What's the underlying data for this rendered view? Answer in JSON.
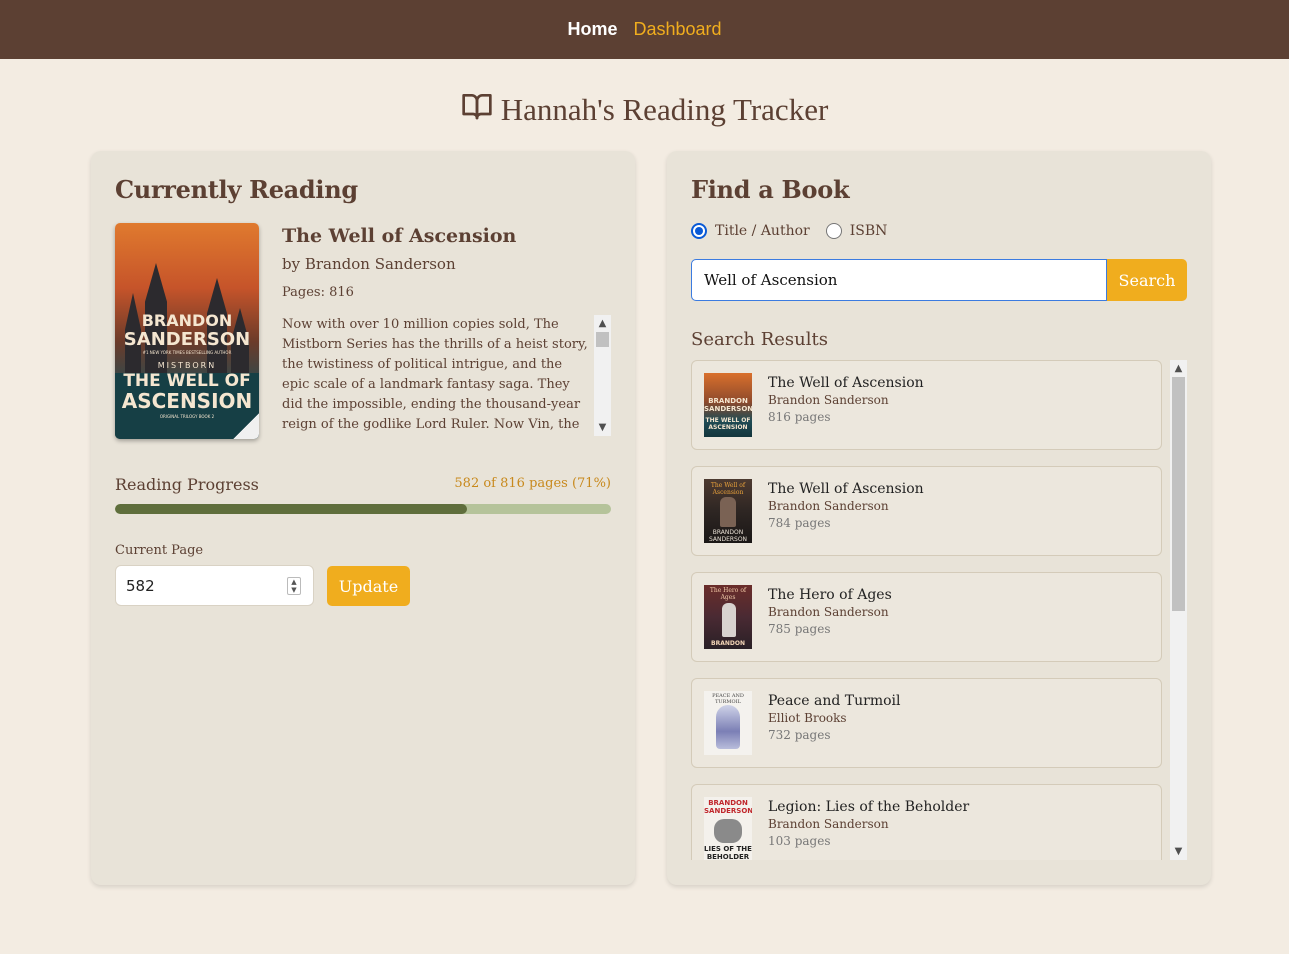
{
  "nav": {
    "home": "Home",
    "dashboard": "Dashboard"
  },
  "page": {
    "title": "Hannah's Reading Tracker"
  },
  "current": {
    "heading": "Currently Reading",
    "cover": {
      "author_line1": "BRANDON",
      "author_line2": "SANDERSON",
      "tagline": "#1 NEW YORK TIMES BESTSELLING AUTHOR",
      "series": "MISTBORN",
      "title_line1": "THE WELL OF",
      "title_line2": "ASCENSION",
      "subtitle": "ORIGINAL TRILOGY BOOK 2"
    },
    "title": "The Well of Ascension",
    "author": "by Brandon Sanderson",
    "pages": "Pages: 816",
    "description": "Now with over 10 million copies sold, The Mistborn Series has the thrills of a heist story, the twistiness of political intrigue, and the epic scale of a landmark fantasy saga. They did the impossible, ending the thousand-year reign of the godlike Lord Ruler. Now Vin, the former street..."
  },
  "progress": {
    "label": "Reading Progress",
    "count": "582 of 816 pages (71%)",
    "fraction": 0.71
  },
  "update_form": {
    "label": "Current Page",
    "value": "582",
    "button": "Update"
  },
  "search": {
    "heading": "Find a Book",
    "options": [
      "Title / Author",
      "ISBN"
    ],
    "selected": "Title / Author",
    "query": "Well of Ascension",
    "button": "Search",
    "results_label": "Search Results",
    "results": [
      {
        "title": "The Well of Ascension",
        "author": "Brandon Sanderson",
        "pages": "816 pages"
      },
      {
        "title": "The Well of Ascension",
        "author": "Brandon Sanderson",
        "pages": "784 pages"
      },
      {
        "title": "The Hero of Ages",
        "author": "Brandon Sanderson",
        "pages": "785 pages"
      },
      {
        "title": "Peace and Turmoil",
        "author": "Elliot Brooks",
        "pages": "732 pages"
      },
      {
        "title": "Legion: Lies of the Beholder",
        "author": "Brandon Sanderson",
        "pages": "103 pages"
      }
    ]
  },
  "colors": {
    "nav_bg": "#5c4033",
    "accent": "#f0ad1e",
    "page_bg": "#f3ece2",
    "panel_bg": "#e8e3d8",
    "progress_fill": "#5f6e3c",
    "progress_track": "#b5c39a"
  },
  "icons": {
    "title": "open-book-icon"
  }
}
